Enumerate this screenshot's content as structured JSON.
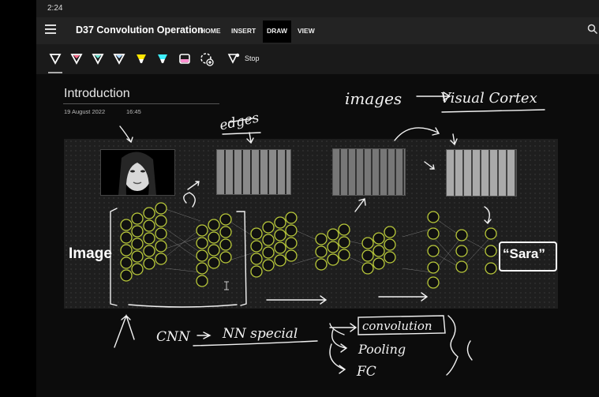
{
  "status": {
    "time": "2:24"
  },
  "header": {
    "title": "D37 Convolution Operation",
    "tabs": [
      {
        "label": "HOME",
        "active": false
      },
      {
        "label": "INSERT",
        "active": false
      },
      {
        "label": "DRAW",
        "active": true
      },
      {
        "label": "VIEW",
        "active": false
      }
    ]
  },
  "toolbar": {
    "pens": [
      {
        "icon": "pen-white-icon",
        "color": "#ffffff"
      },
      {
        "icon": "pen-pink-icon",
        "color": "#ff6b8a"
      },
      {
        "icon": "pen-teal-icon",
        "color": "#6fe3d2"
      },
      {
        "icon": "pen-lightblue-icon",
        "color": "#a9d8ff"
      },
      {
        "icon": "highlighter-yellow-icon",
        "color": "#ffe600"
      },
      {
        "icon": "highlighter-cyan-icon",
        "color": "#3ff0ff"
      }
    ],
    "eraser_icon": "eraser-icon",
    "lasso_icon": "lasso-add-icon",
    "stop_label": "Stop"
  },
  "page": {
    "title": "Introduction",
    "date": "19 August 2022",
    "time": "16:45"
  },
  "slide": {
    "input_label": "Image",
    "output_label": "“Sara”"
  },
  "ink": {
    "edges": "edges",
    "images": "images",
    "visual_cortex": "Visual Cortex",
    "cnn": "CNN",
    "nn_special": "NN special",
    "convolution": "convolution",
    "pooling": "Pooling",
    "fc": "FC"
  }
}
